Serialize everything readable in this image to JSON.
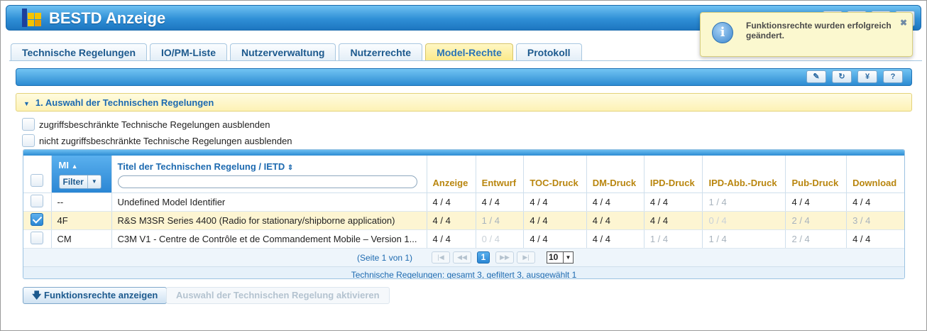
{
  "app": {
    "title": "BESTD Anzeige"
  },
  "tabs": [
    {
      "label": "Technische Regelungen"
    },
    {
      "label": "IO/PM-Liste"
    },
    {
      "label": "Nutzerverwaltung"
    },
    {
      "label": "Nutzerrechte"
    },
    {
      "label": "Model-Rechte",
      "active": true
    },
    {
      "label": "Protokoll"
    }
  ],
  "toolbar": {
    "icons": [
      "edit-icon",
      "refresh-icon",
      "yen-icon",
      "help-icon"
    ],
    "yen_label": "¥",
    "help_label": "?"
  },
  "section": {
    "title": "1. Auswahl der Technischen Regelungen"
  },
  "filters": {
    "hide_restricted": "zugriffsbeschränkte Technische Regelungen ausblenden",
    "hide_unrestricted": "nicht zugriffsbeschränkte Technische Regelungen ausblenden"
  },
  "grid": {
    "columns": {
      "mi": "MI",
      "filter": "Filter",
      "titel": "Titel der Technischen Regelung / IETD",
      "anzeige": "Anzeige",
      "entwurf": "Entwurf",
      "toc": "TOC-Druck",
      "dm": "DM-Druck",
      "ipd": "IPD-Druck",
      "ipd_abb": "IPD-Abb.-Druck",
      "pub": "Pub-Druck",
      "download": "Download"
    },
    "rows": [
      {
        "selected": false,
        "mi": "--",
        "titel": "Undefined Model Identifier",
        "anzeige": "4 / 4",
        "entwurf": "4 / 4",
        "toc": "4 / 4",
        "dm": "4 / 4",
        "ipd": "4 / 4",
        "ipd_abb": "1 / 4",
        "pub": "4 / 4",
        "download": "4 / 4"
      },
      {
        "selected": true,
        "mi": "4F",
        "titel": "R&S M3SR Series 4400 (Radio for stationary/shipborne application)",
        "anzeige": "4 / 4",
        "entwurf": "1 / 4",
        "toc": "4 / 4",
        "dm": "4 / 4",
        "ipd": "4 / 4",
        "ipd_abb": "0 / 4",
        "pub": "2 / 4",
        "download": "3 / 4"
      },
      {
        "selected": false,
        "mi": "CM",
        "titel": "C3M V1 - Centre de Contrôle et de Commandement Mobile – Version 1...",
        "anzeige": "4 / 4",
        "entwurf": "0 / 4",
        "toc": "4 / 4",
        "dm": "4 / 4",
        "ipd": "1 / 4",
        "ipd_abb": "1 / 4",
        "pub": "2 / 4",
        "download": "4 / 4"
      }
    ],
    "pager": {
      "text": "(Seite 1 von 1)",
      "current_page": "1",
      "page_size": "10"
    },
    "status": "Technische Regelungen: gesamt 3, gefiltert 3, ausgewählt 1"
  },
  "buttons": {
    "show_rights": "Funktionsrechte anzeigen",
    "activate": "Auswahl der Technischen Regelung aktivieren"
  },
  "notification": {
    "text": "Funktionsrechte wurden erfolgreich geändert.",
    "icon": "info-icon"
  }
}
